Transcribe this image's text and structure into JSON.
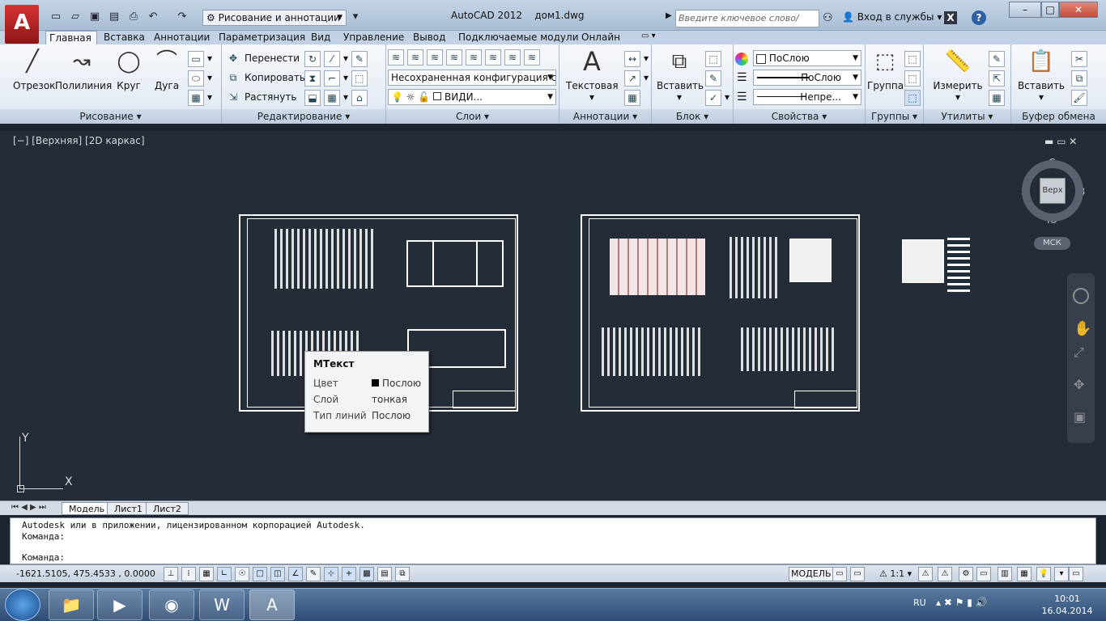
{
  "app": {
    "title": "AutoCAD 2012",
    "document": "дом1.dwg",
    "workspace": "Рисование и аннотации",
    "search_placeholder": "Введите ключевое слово/фразу",
    "signin": "Вход в службы"
  },
  "ribbon_tabs": [
    "Главная",
    "Вставка",
    "Аннотации",
    "Параметризация",
    "Вид",
    "Управление",
    "Вывод",
    "Подключаемые модули",
    "Онлайн"
  ],
  "draw_panel": {
    "title": "Рисование",
    "tools": [
      "Отрезок",
      "Полилиния",
      "Круг",
      "Дуга"
    ]
  },
  "modify_panel": {
    "title": "Редактирование",
    "tools": [
      "Перенести",
      "Копировать",
      "Растянуть"
    ]
  },
  "layers_panel": {
    "title": "Слои",
    "config": "Несохраненная конфигурация сло",
    "layer": "ВИДИ..."
  },
  "annotation_panel": {
    "title": "Аннотации",
    "tool": "Текстовая"
  },
  "block_panel": {
    "title": "Блок",
    "tool": "Вставить"
  },
  "properties_panel": {
    "title": "Свойства",
    "color": "ПоСлою",
    "lineweight": "ПоСлою",
    "linetype": "Непре..."
  },
  "groups_panel": {
    "title": "Группы",
    "tool": "Группа"
  },
  "utilities_panel": {
    "title": "Утилиты",
    "tool": "Измерить"
  },
  "clipboard_panel": {
    "title": "Буфер обмена",
    "tool": "Вставить"
  },
  "viewport": {
    "label": "[−] [Верхняя] [2D каркас]"
  },
  "viewcube": {
    "north": "С",
    "south": "Ю",
    "west": "З",
    "east": "В",
    "face": "Верх",
    "ucs": "МСК"
  },
  "tooltip": {
    "title": "МТекст",
    "rows": [
      {
        "key": "Цвет",
        "value": "Послою"
      },
      {
        "key": "Слой",
        "value": "тонкая"
      },
      {
        "key": "Тип линий",
        "value": "Послою"
      }
    ]
  },
  "axes": {
    "x": "X",
    "y": "Y"
  },
  "layout_tabs": [
    "Модель",
    "Лист1",
    "Лист2"
  ],
  "command": {
    "line1": "Autodesk или в приложении, лицензированном корпорацией Autodesk.",
    "line2": "Команда:",
    "prompt": "Команда:"
  },
  "status": {
    "coords": "-1621.5105, 475.4533 , 0.0000",
    "mode": "МОДЕЛЬ",
    "scale": "1:1"
  },
  "taskbar": {
    "lang": "RU",
    "time": "10:01",
    "date": "16.04.2014"
  }
}
